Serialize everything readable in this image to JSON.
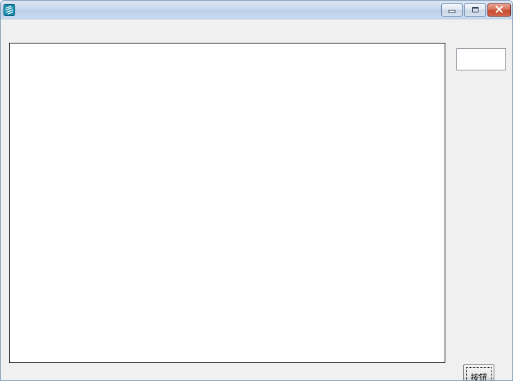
{
  "window": {
    "title": "",
    "icons": {
      "app": "app-icon",
      "minimize": "minimize-icon",
      "maximize": "maximize-icon",
      "close": "close-icon"
    }
  },
  "main": {
    "text_input": {
      "value": "",
      "placeholder": ""
    },
    "button_label": "按钮"
  },
  "colors": {
    "close_button": "#c74a30",
    "client_background": "#f0f0f0"
  }
}
